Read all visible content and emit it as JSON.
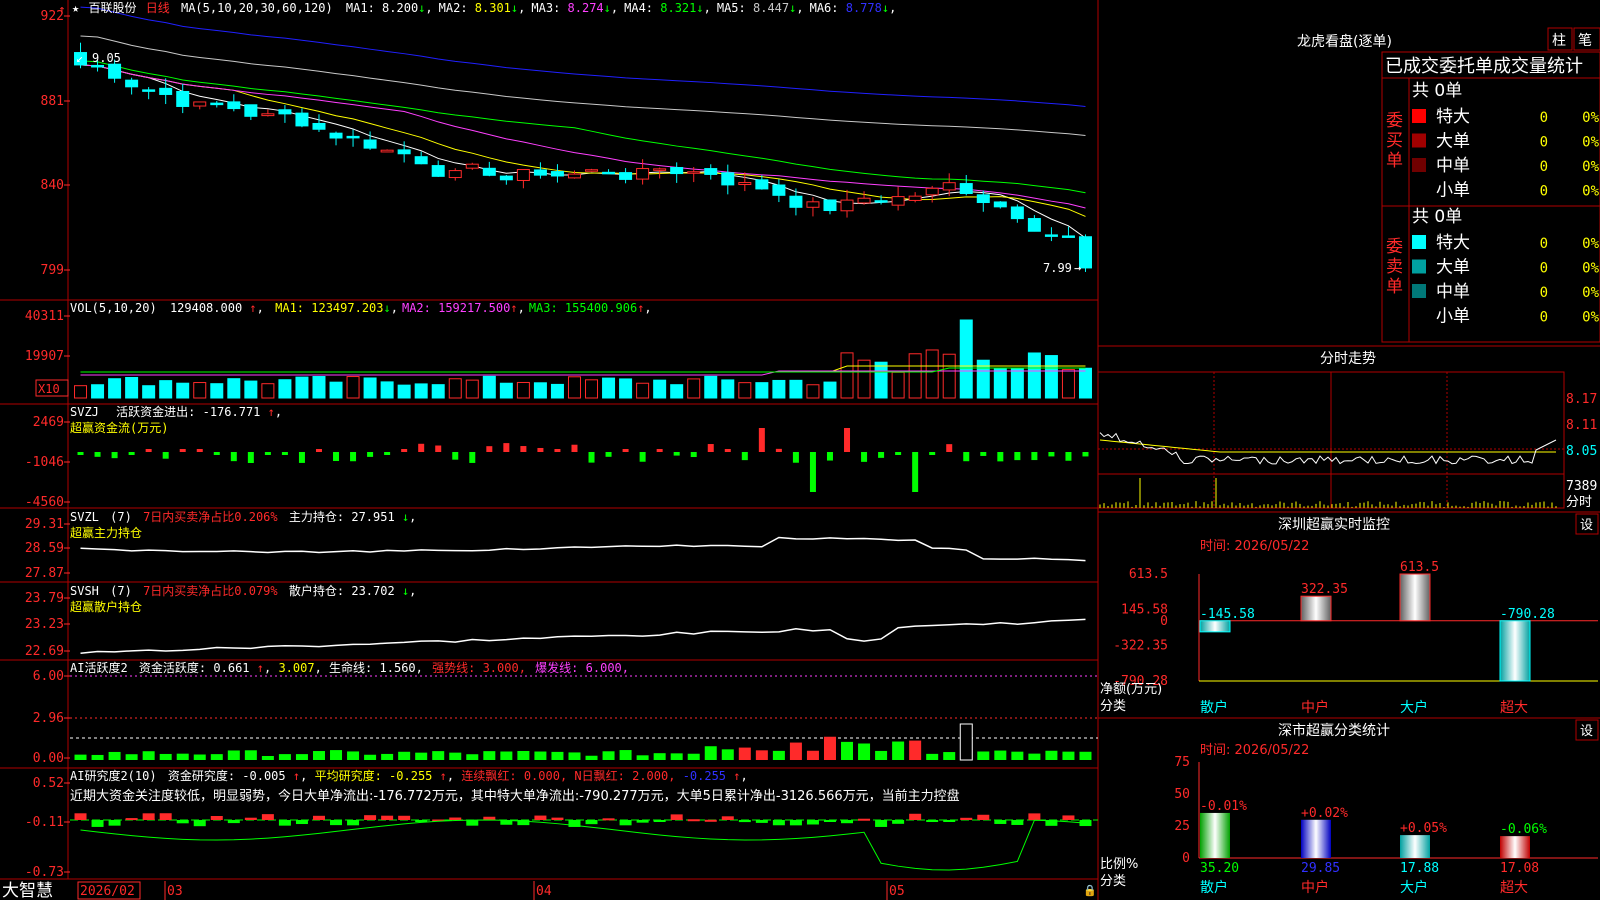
{
  "colors": {
    "up": "#ff2a2a",
    "down": "#00ffff",
    "bg": "#000000",
    "frame": "#b00000",
    "yellow": "#ffff00",
    "magenta": "#ff40ff",
    "green": "#00ff00",
    "blue": "#2020ff",
    "white": "#ffffff",
    "grey": "#9a9a9a"
  },
  "stock": {
    "star": "★",
    "name": "百联股份",
    "period": "日线"
  },
  "main": {
    "ma_spec": "MA(5,10,20,30,60,120)",
    "ma_items": [
      {
        "label": "MA1:",
        "value": "8.200",
        "arrow": "↓",
        "color": "#ffffff"
      },
      {
        "label": "MA2:",
        "value": "8.301",
        "arrow": "↓",
        "color": "#ffff00"
      },
      {
        "label": "MA3:",
        "value": "8.274",
        "arrow": "↓",
        "color": "#ff40ff"
      },
      {
        "label": "MA4:",
        "value": "8.321",
        "arrow": "↓",
        "color": "#00ff00"
      },
      {
        "label": "MA5:",
        "value": "8.447",
        "arrow": "↓",
        "color": "#c8c8c8"
      },
      {
        "label": "MA6:",
        "value": "8.778",
        "arrow": "↓",
        "color": "#3030ff"
      }
    ],
    "y_ticks": [
      "922",
      "881",
      "840",
      "799"
    ],
    "high_label": "9.05",
    "low_label": "7.99"
  },
  "vol": {
    "spec": "VOL(5,10,20)",
    "value": "129408.000",
    "value_arrow": "↑",
    "ma_items": [
      {
        "label": "MA1:",
        "value": "123497.203",
        "arrow": "↓",
        "color": "#ffff00"
      },
      {
        "label": "MA2:",
        "value": "159217.500",
        "arrow": "↑",
        "color": "#ff40ff"
      },
      {
        "label": "MA3:",
        "value": "155400.906",
        "arrow": "↑",
        "color": "#00ff00"
      }
    ],
    "y_ticks": [
      "40311",
      "19907"
    ],
    "unit": "X10"
  },
  "svzj": {
    "name": "SVZJ",
    "label": "活跃资金进出:",
    "value": "-176.771",
    "arrow": "↑",
    "subtitle": "超赢资金流(万元)",
    "y_ticks": [
      "2469",
      "-1046",
      "-4560"
    ]
  },
  "svzl": {
    "name": "SVZL",
    "param": "(7)",
    "metric": "7日内买卖净占比0.206%",
    "label": "主力持仓:",
    "value": "27.951",
    "arrow": "↓",
    "subtitle": "超赢主力持仓",
    "y_ticks": [
      "29.31",
      "28.59",
      "27.87"
    ]
  },
  "svsh": {
    "name": "SVSH",
    "param": "(7)",
    "metric": "7日内买卖净占比0.079%",
    "label": "散户持仓:",
    "value": "23.702",
    "arrow": "↓",
    "subtitle": "超赢散户持仓",
    "y_ticks": [
      "23.79",
      "23.23",
      "22.69"
    ]
  },
  "ai1": {
    "name": "AI活跃度2",
    "label": "资金活跃度:",
    "value": "0.661",
    "value_arrow": "↑",
    "value2": "3.007",
    "life_label": "生命线:",
    "life_value": "1.560",
    "strong_label": "强势线:",
    "strong_value": "3.000",
    "burst_label": "爆发线:",
    "burst_value": "6.000",
    "y_ticks": [
      "6.00",
      "2.96",
      "0.00"
    ]
  },
  "ai2": {
    "name": "AI研究度2(10)",
    "label": "资金研究度:",
    "value": "-0.005",
    "avg_label": "平均研究度:",
    "avg_value": "-0.255",
    "lian_label": "连续飘红:",
    "lian_value": "0.000",
    "n_label": "N日飘红:",
    "n_value": "2.000",
    "last_value": "-0.255",
    "comment": "近期大资金关注度较低，明显弱势，今日大单净流出:-176.772万元，其中特大单净流出:-790.277万元，大单5日累计净出-3126.566万元，当前主力控盘",
    "y_ticks": [
      "0.52",
      "-0.11",
      "-0.73"
    ]
  },
  "xaxis": {
    "brand": "大智慧",
    "labels": [
      "2026/02",
      "03",
      "04",
      "05"
    ]
  },
  "dragon": {
    "title": "龙虎看盘(逐单)",
    "tabs": [
      "柱",
      "笔"
    ],
    "header": "已成交委托单成交量统计",
    "buy": {
      "side": "委买单",
      "total": "共 0单",
      "rows": [
        {
          "label": "特大",
          "count": "0",
          "pct": "0%",
          "color": "#ff0000"
        },
        {
          "label": "大单",
          "count": "0",
          "pct": "0%",
          "color": "#a00000"
        },
        {
          "label": "中单",
          "count": "0",
          "pct": "0%",
          "color": "#700000"
        },
        {
          "label": "小单",
          "count": "0",
          "pct": "0%",
          "color": ""
        }
      ]
    },
    "sell": {
      "side": "委卖单",
      "total": "共 0单",
      "rows": [
        {
          "label": "特大",
          "count": "0",
          "pct": "0%",
          "color": "#00ffff"
        },
        {
          "label": "大单",
          "count": "0",
          "pct": "0%",
          "color": "#00a0a0"
        },
        {
          "label": "中单",
          "count": "0",
          "pct": "0%",
          "color": "#007878"
        },
        {
          "label": "小单",
          "count": "0",
          "pct": "0%",
          "color": ""
        }
      ]
    }
  },
  "intraday": {
    "title": "分时走势",
    "prices": [
      "8.17",
      "8.11",
      "8.05"
    ],
    "vol": "7389",
    "unit": "分时"
  },
  "monitor": {
    "title": "深圳超赢实时监控",
    "setting": "设",
    "time": "时间: 2026/05/22",
    "y_ticks": [
      "613.5",
      "145.58",
      "0",
      "-322.35",
      "-790.28"
    ],
    "ylabel": "净额(万元)",
    "xlabel": "分类",
    "chart_data": {
      "type": "bar",
      "categories": [
        "散户",
        "中户",
        "大户",
        "超大"
      ],
      "values": [
        -145.58,
        322.35,
        613.5,
        -790.28
      ],
      "ylim": [
        -790.28,
        613.5
      ]
    },
    "value_labels": [
      "-145.58",
      "322.35",
      "613.5",
      "-790.28"
    ]
  },
  "classify": {
    "title": "深市超赢分类统计",
    "setting": "设",
    "time": "时间: 2026/05/22",
    "y_ticks": [
      "75",
      "50",
      "25",
      "0"
    ],
    "ylabel": "比例%",
    "xlabel": "分类",
    "chart_data": {
      "type": "bar",
      "categories": [
        "散户",
        "中户",
        "大户",
        "超大"
      ],
      "values": [
        35.2,
        29.85,
        17.88,
        17.08
      ],
      "changes": [
        "-0.01%",
        "+0.02%",
        "+0.05%",
        "-0.06%"
      ],
      "ylim": [
        0,
        75
      ]
    }
  }
}
